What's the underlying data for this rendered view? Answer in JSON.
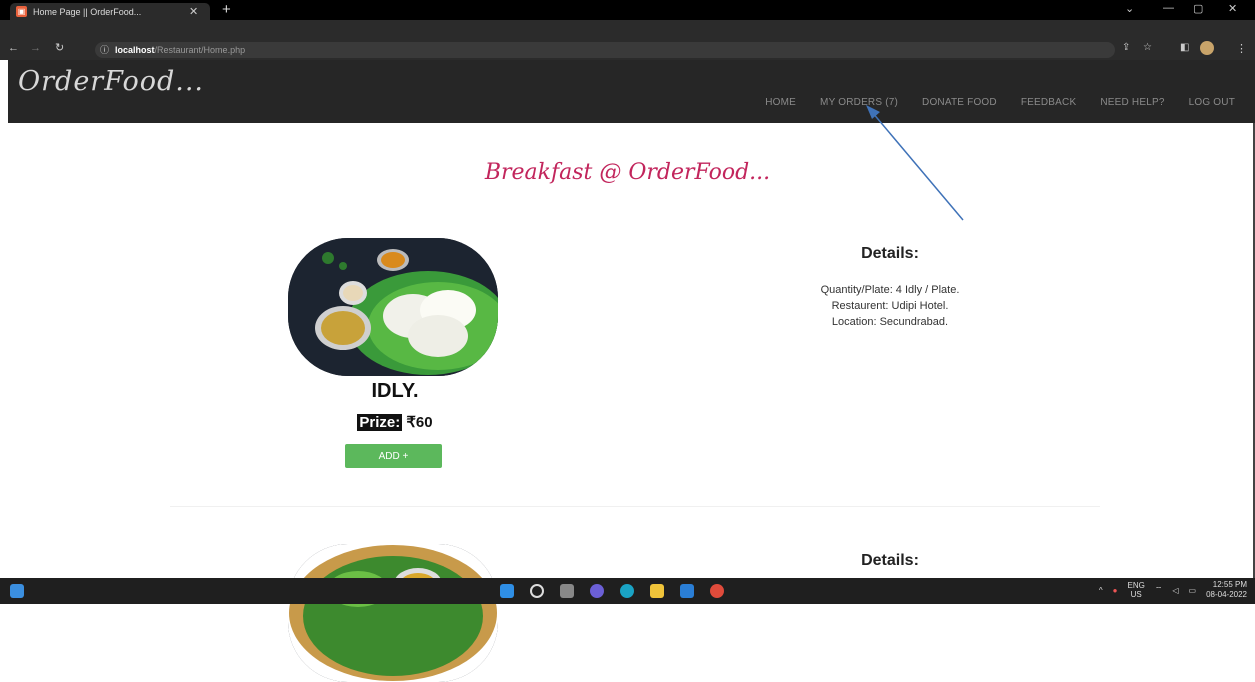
{
  "browser": {
    "tab_title": "Home Page || OrderFood...",
    "url_host": "localhost",
    "url_path": "/Restaurant/Home.php"
  },
  "site": {
    "logo": "OrderFood...",
    "nav": [
      "HOME",
      "MY ORDERS (7)",
      "DONATE FOOD",
      "FEEDBACK",
      "NEED HELP?",
      "LOG OUT"
    ]
  },
  "page": {
    "title": "Breakfast @ OrderFood...",
    "items": [
      {
        "name": "IDLY.",
        "price_label": "Prize:",
        "price_value": "₹60",
        "add_button": "ADD +",
        "details_heading": "Details:",
        "details": [
          "Quantity/Plate: 4 Idly / Plate.",
          "Restaurent: Udipi Hotel.",
          "Location: Secundrabad."
        ]
      },
      {
        "details_heading": "Details:"
      }
    ]
  },
  "taskbar": {
    "lang_top": "ENG",
    "lang_bottom": "US",
    "time": "12:55 PM",
    "date": "08-04-2022"
  },
  "colors": {
    "accent_title": "#c2255c",
    "add_button": "#5cb85c",
    "header_bg": "#262626"
  }
}
